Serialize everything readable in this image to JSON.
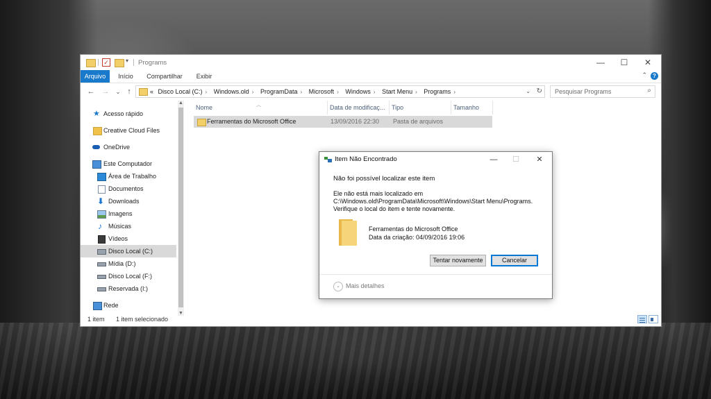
{
  "explorer": {
    "title": "Programs",
    "controls": {
      "minimize": "—",
      "maximize": "☐",
      "close": "✕"
    },
    "ribbon_tabs": [
      "Arquivo",
      "Início",
      "Compartilhar",
      "Exibir"
    ],
    "help": "?",
    "nav": {
      "back": "←",
      "forward": "→",
      "dropdown": "⌄",
      "up": "↑"
    },
    "address": {
      "overflow": "«",
      "crumbs": [
        "Disco Local (C:)",
        "Windows.old",
        "ProgramData",
        "Microsoft",
        "Windows",
        "Start Menu",
        "Programs"
      ],
      "dropdown": "⌄",
      "refresh": "↻"
    },
    "search": {
      "placeholder": "Pesquisar Programs",
      "icon": "search-icon"
    },
    "sidebar": {
      "items": [
        {
          "label": "Acesso rápido",
          "icon": "star-icon"
        },
        {
          "label": "Creative Cloud Files",
          "icon": "creative-cloud-icon"
        },
        {
          "label": "OneDrive",
          "icon": "cloud-icon"
        },
        {
          "label": "Este Computador",
          "icon": "computer-icon"
        },
        {
          "label": "Área de Trabalho",
          "icon": "desktop-icon"
        },
        {
          "label": "Documentos",
          "icon": "document-icon"
        },
        {
          "label": "Downloads",
          "icon": "download-icon"
        },
        {
          "label": "Imagens",
          "icon": "image-icon"
        },
        {
          "label": "Músicas",
          "icon": "music-icon"
        },
        {
          "label": "Vídeos",
          "icon": "video-icon"
        },
        {
          "label": "Disco Local (C:)",
          "icon": "drive-icon",
          "selected": true
        },
        {
          "label": "Mídia (D:)",
          "icon": "drive-icon"
        },
        {
          "label": "Disco Local (F:)",
          "icon": "drive-icon"
        },
        {
          "label": "Reservada (I:)",
          "icon": "drive-icon"
        },
        {
          "label": "Rede",
          "icon": "network-icon"
        }
      ]
    },
    "columns": [
      "Nome",
      "Data de modificaç...",
      "Tipo",
      "Tamanho"
    ],
    "rows": [
      {
        "name": "Ferramentas do Microsoft Office",
        "modified": "13/09/2016 22:30",
        "type": "Pasta de arquivos",
        "size": ""
      }
    ],
    "status": {
      "count": "1 item",
      "selected": "1 item selecionado"
    }
  },
  "dialog": {
    "title": "Item Não Encontrado",
    "heading": "Não foi possível localizar este item",
    "body_line1": "Ele não está mais localizado em",
    "body_line2": "C:\\Windows.old\\ProgramData\\Microsoft\\Windows\\Start Menu\\Programs.",
    "body_line3": "Verifique o local do item e tente novamente.",
    "item_name": "Ferramentas do Microsoft Office",
    "item_date": "Data da criação: 04/09/2016 19:06",
    "retry_label": "Tentar novamente",
    "cancel_label": "Cancelar",
    "more_details": "Mais detalhes",
    "controls": {
      "minimize": "—",
      "maximize": "☐",
      "close": "✕"
    }
  },
  "colors": {
    "accent": "#1979ca",
    "selection": "#d9d9d9",
    "folder": "#f3cf6a"
  }
}
